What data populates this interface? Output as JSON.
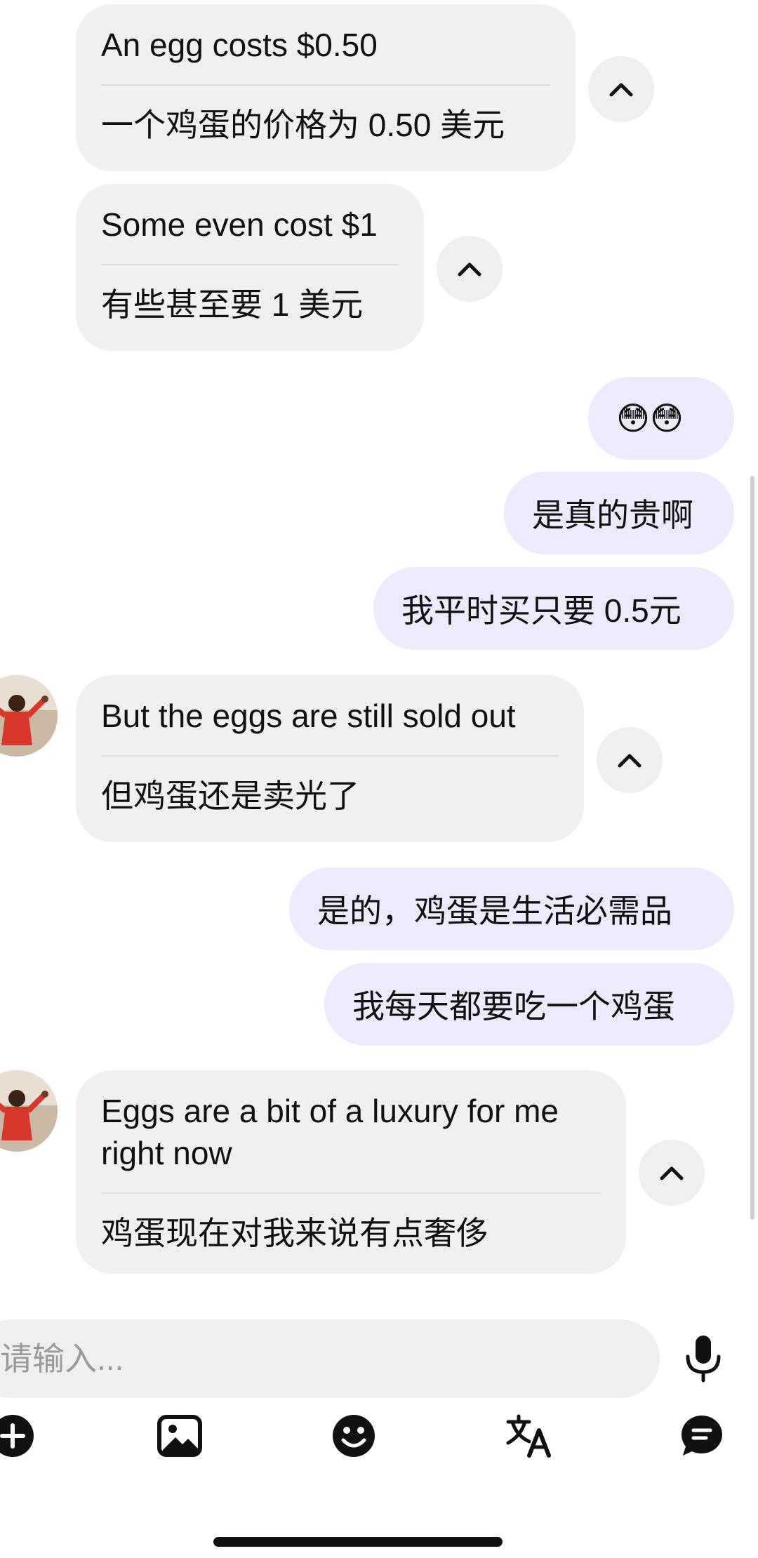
{
  "messages": [
    {
      "side": "in",
      "original": "An egg costs $0.50",
      "translation": "一个鸡蛋的价格为 0.50 美元"
    },
    {
      "side": "in",
      "original": "Some even cost $1",
      "translation": "有些甚至要 1 美元"
    },
    {
      "side": "out",
      "text": "😳😳"
    },
    {
      "side": "out",
      "text": "是真的贵啊"
    },
    {
      "side": "out",
      "text": "我平时买只要 0.5元"
    },
    {
      "side": "in",
      "original": "But the eggs are still sold out",
      "translation": "但鸡蛋还是卖光了"
    },
    {
      "side": "out",
      "text": "是的，鸡蛋是生活必需品"
    },
    {
      "side": "out",
      "text": "我每天都要吃一个鸡蛋"
    },
    {
      "side": "in",
      "original": "Eggs are a bit of a luxury for me right now",
      "translation": "鸡蛋现在对我来说有点奢侈"
    }
  ],
  "composer": {
    "placeholder": "请输入...",
    "value": ""
  },
  "toolbar": {
    "icons": [
      "plus-circle-icon",
      "image-icon",
      "emoji-icon",
      "translate-icon",
      "chat-bubble-icon"
    ],
    "mic_icon": "microphone-icon"
  },
  "colors": {
    "incoming_bubble": "#f0f0f0",
    "outgoing_bubble": "#eceafb",
    "icon": "#111111"
  }
}
